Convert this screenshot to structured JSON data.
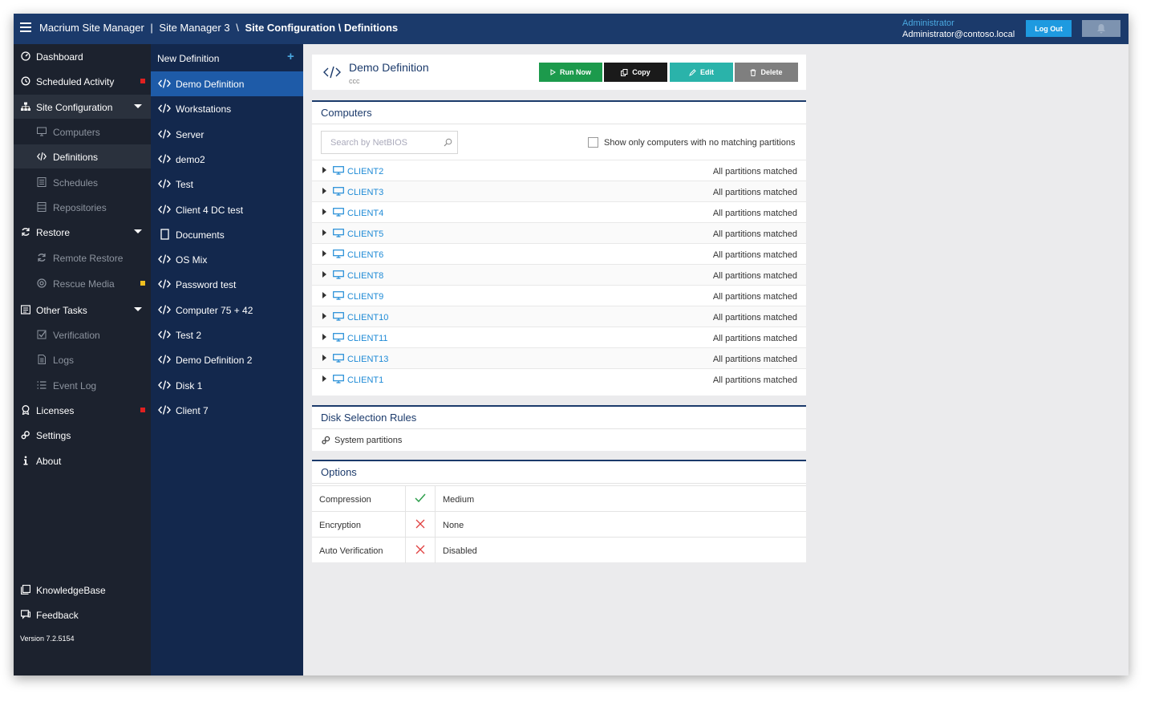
{
  "topbar": {
    "app_name": "Macrium Site Manager",
    "sep1": "|",
    "site": "Site Manager 3",
    "sep2": "\\",
    "path": "Site Configuration \\ Definitions",
    "user_role": "Administrator",
    "user_email": "Administrator@contoso.local",
    "logout_label": "Log Out"
  },
  "sidebar": {
    "items": [
      {
        "label": "Dashboard",
        "icon": "dashboard-icon"
      },
      {
        "label": "Scheduled Activity",
        "icon": "history-icon",
        "flag": "#e02020"
      },
      {
        "label": "Site Configuration",
        "icon": "sitemap-icon",
        "expanded": true
      },
      {
        "label": "Computers",
        "icon": "monitor-icon"
      },
      {
        "label": "Definitions",
        "icon": "code-icon",
        "active": true
      },
      {
        "label": "Schedules",
        "icon": "list-icon"
      },
      {
        "label": "Repositories",
        "icon": "database-icon"
      },
      {
        "label": "Restore",
        "icon": "refresh-icon",
        "expanded": true
      },
      {
        "label": "Remote Restore",
        "icon": "refresh-icon"
      },
      {
        "label": "Rescue Media",
        "icon": "lifebuoy-icon",
        "flag": "#f0c020"
      },
      {
        "label": "Other Tasks",
        "icon": "tasks-icon",
        "expanded": true
      },
      {
        "label": "Verification",
        "icon": "check-square-icon"
      },
      {
        "label": "Logs",
        "icon": "file-icon"
      },
      {
        "label": "Event Log",
        "icon": "list-lines-icon"
      },
      {
        "label": "Licenses",
        "icon": "award-icon",
        "flag": "#e02020"
      },
      {
        "label": "Settings",
        "icon": "gear-icon"
      },
      {
        "label": "About",
        "icon": "info-icon"
      }
    ],
    "bottom": [
      {
        "label": "KnowledgeBase",
        "icon": "book-icon"
      },
      {
        "label": "Feedback",
        "icon": "feedback-icon"
      }
    ],
    "version": "Version 7.2.5154"
  },
  "definitions": {
    "new_label": "New Definition",
    "items": [
      "Demo Definition",
      "Workstations",
      "Server",
      "demo2",
      "Test",
      "Client 4 DC test",
      "Documents",
      "OS Mix",
      "Password test",
      "Computer 75 + 42",
      "Test 2",
      "Demo Definition 2",
      "Disk 1",
      "Client 7"
    ]
  },
  "definition": {
    "title": "Demo Definition",
    "subtitle": "ccc",
    "buttons": {
      "run": "Run Now",
      "copy": "Copy",
      "edit": "Edit",
      "delete": "Delete"
    }
  },
  "computers": {
    "title": "Computers",
    "search_placeholder": "Search by NetBIOS",
    "filter_label": "Show only computers with no matching partitions",
    "rows": [
      {
        "name": "CLIENT2",
        "status": "All partitions matched"
      },
      {
        "name": "CLIENT3",
        "status": "All partitions matched"
      },
      {
        "name": "CLIENT4",
        "status": "All partitions matched"
      },
      {
        "name": "CLIENT5",
        "status": "All partitions matched"
      },
      {
        "name": "CLIENT6",
        "status": "All partitions matched"
      },
      {
        "name": "CLIENT8",
        "status": "All partitions matched"
      },
      {
        "name": "CLIENT9",
        "status": "All partitions matched"
      },
      {
        "name": "CLIENT10",
        "status": "All partitions matched"
      },
      {
        "name": "CLIENT11",
        "status": "All partitions matched"
      },
      {
        "name": "CLIENT13",
        "status": "All partitions matched"
      },
      {
        "name": "CLIENT1",
        "status": "All partitions matched"
      }
    ]
  },
  "disk_rules": {
    "title": "Disk Selection Rules",
    "rule": "System partitions"
  },
  "options": {
    "title": "Options",
    "rows": [
      {
        "key": "Compression",
        "enabled": true,
        "value": "Medium"
      },
      {
        "key": "Encryption",
        "enabled": false,
        "value": "None"
      },
      {
        "key": "Auto Verification",
        "enabled": false,
        "value": "Disabled"
      }
    ]
  },
  "colors": {
    "topbar": "#1b3a6b",
    "sidebar": "#1c222e",
    "deflist": "#13284d",
    "accent": "#1e8ad6",
    "run": "#1c9a4c",
    "edit": "#2ab3aa",
    "check": "#2e9e4c",
    "cross": "#e04040"
  }
}
